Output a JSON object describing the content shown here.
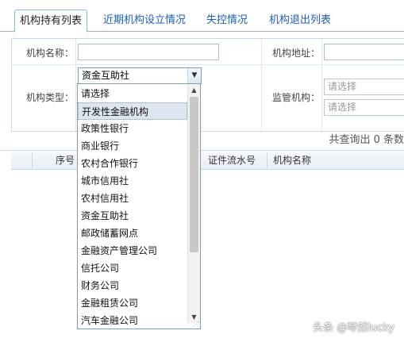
{
  "tabs": [
    {
      "label": "机构持有列表",
      "active": true
    },
    {
      "label": "近期机构设立情况",
      "active": false
    },
    {
      "label": "失控情况",
      "active": false
    },
    {
      "label": "机构退出列表",
      "active": false
    }
  ],
  "form": {
    "name_label": "机构名称：",
    "address_label": "机构地址：",
    "type_label": "机构类型：",
    "type_value": "资金互助社",
    "regulator_label": "监管机构：",
    "regulator_placeholder_1": "请选择",
    "regulator_placeholder_2": "请选择"
  },
  "result": {
    "text": "共查询出 0 条数"
  },
  "table": {
    "headers": [
      "序号",
      "证件流水号",
      "机构名称"
    ]
  },
  "dropdown": {
    "options": [
      "请选择",
      "开发性金融机构",
      "政策性银行",
      "商业银行",
      "农村合作银行",
      "城市信用社",
      "农村信用社",
      "资金互助社",
      "邮政储蓄网点",
      "金融资产管理公司",
      "信托公司",
      "财务公司",
      "金融租赁公司",
      "汽车金融公司"
    ],
    "hover_index": 1
  },
  "watermark": "头条 @琴然lucky"
}
